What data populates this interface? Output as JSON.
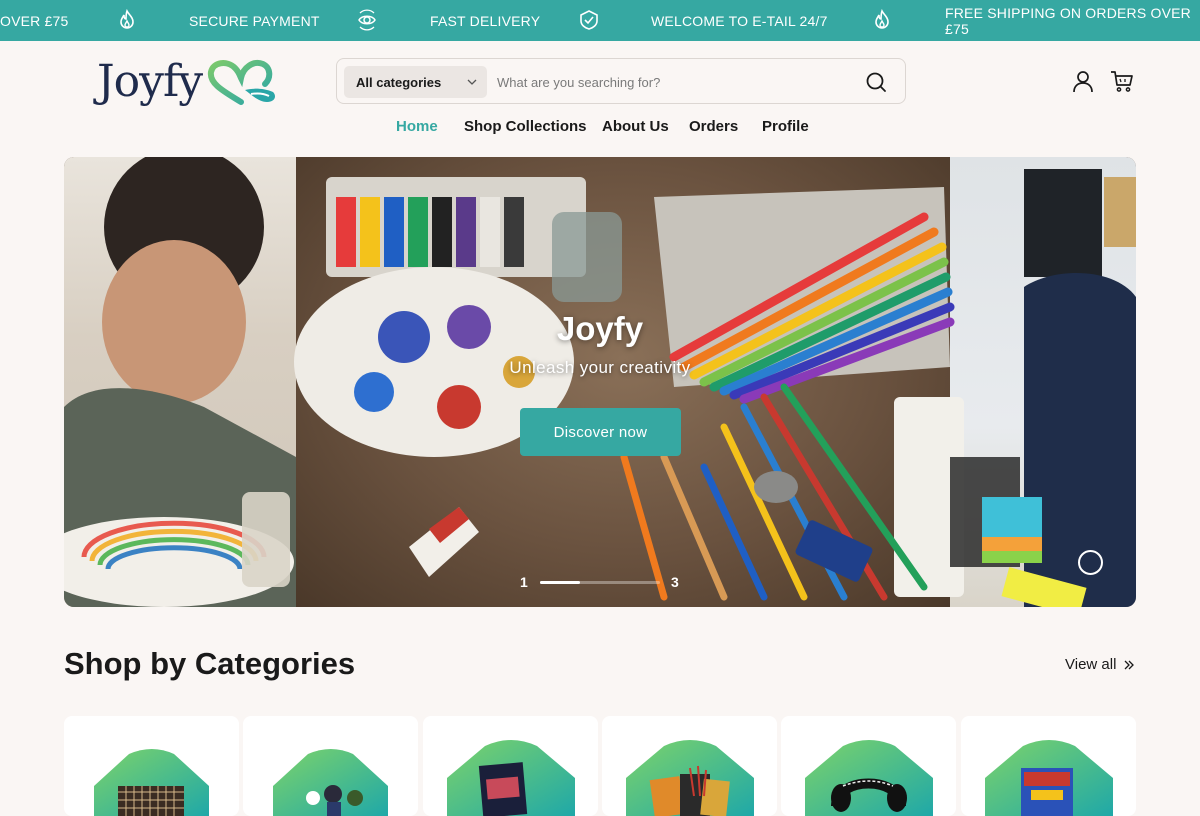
{
  "announcement": {
    "items": [
      {
        "text": "OVER £75",
        "icon": "flame-icon"
      },
      {
        "text": "SECURE PAYMENT",
        "icon": "eye-ring-icon"
      },
      {
        "text": "FAST DELIVERY",
        "icon": "shield-check-icon"
      },
      {
        "text": "WELCOME TO E-TAIL 24/7",
        "icon": "flame-icon"
      },
      {
        "text": "FREE SHIPPING ON ORDERS OVER £75",
        "icon": ""
      }
    ],
    "background": "#36a8a2"
  },
  "header": {
    "logo_text": "Joyfy",
    "search": {
      "category_label": "All categories",
      "placeholder": "What are you searching for?",
      "value": ""
    },
    "icons": [
      "account-icon",
      "cart-icon"
    ]
  },
  "nav": {
    "items": [
      {
        "label": "Home",
        "active": true
      },
      {
        "label": "Shop Collections",
        "active": false
      },
      {
        "label": "About Us",
        "active": false
      },
      {
        "label": "Orders",
        "active": false
      },
      {
        "label": "Profile",
        "active": false
      }
    ]
  },
  "hero": {
    "title": "Joyfy",
    "subtitle": "Unleash your creativity",
    "button_label": "Discover now",
    "pager": {
      "current": "1",
      "total": "3",
      "progress": 0.33
    }
  },
  "categories": {
    "title": "Shop by Categories",
    "view_all_label": "View all",
    "cards": [
      {
        "icon": "chess-board-icon"
      },
      {
        "icon": "figurines-icon"
      },
      {
        "icon": "poster-icon"
      },
      {
        "icon": "art-supplies-icon"
      },
      {
        "icon": "headphones-icon"
      },
      {
        "icon": "board-game-icon"
      }
    ]
  },
  "colors": {
    "accent": "#36a8a2",
    "text": "#1a1a1a",
    "page_bg": "#faf6f4"
  }
}
